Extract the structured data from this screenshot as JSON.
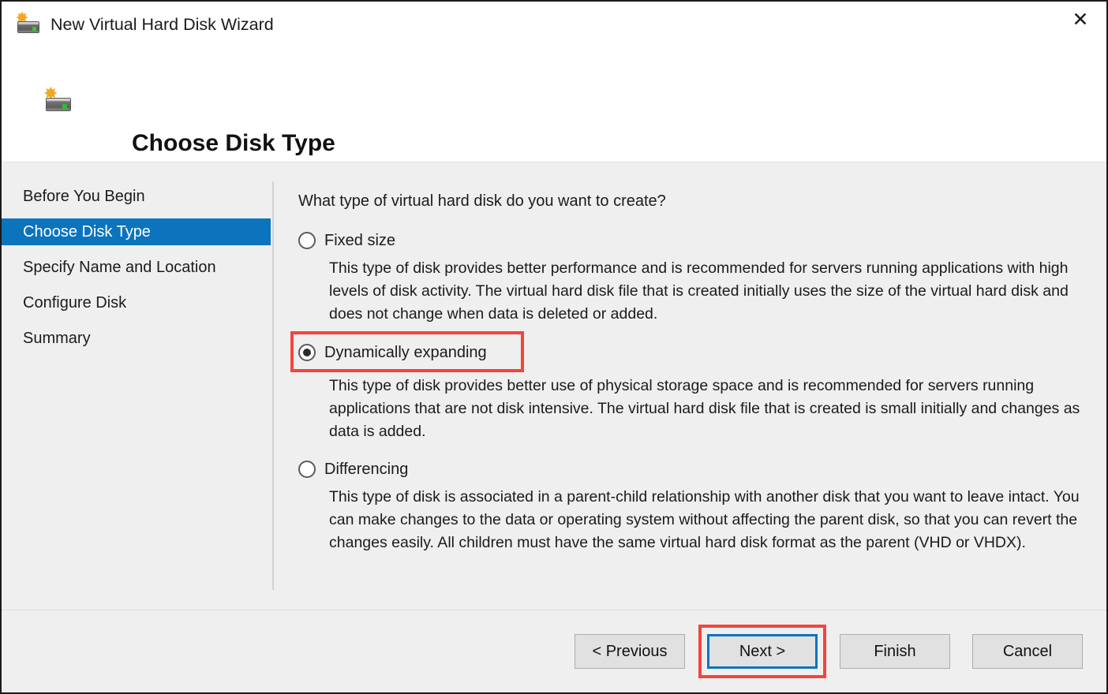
{
  "window": {
    "title": "New Virtual Hard Disk Wizard",
    "title_icon": "virtual-hard-disk-icon",
    "close_label": "✕"
  },
  "header": {
    "icon": "virtual-hard-disk-icon",
    "star_glyph": "✸",
    "page_title": "Choose Disk Type"
  },
  "sidebar": {
    "items": [
      {
        "label": "Before You Begin",
        "selected": false
      },
      {
        "label": "Choose Disk Type",
        "selected": true
      },
      {
        "label": "Specify Name and Location",
        "selected": false
      },
      {
        "label": "Configure Disk",
        "selected": false
      },
      {
        "label": "Summary",
        "selected": false
      }
    ],
    "selected_color": "#0b74bd"
  },
  "main": {
    "question": "What type of virtual hard disk do you want to create?",
    "options": [
      {
        "id": "fixed-size",
        "label": "Fixed size",
        "checked": false,
        "highlighted": false,
        "description": "This type of disk provides better performance and is recommended for servers running applications with high levels of disk activity. The virtual hard disk file that is created initially uses the size of the virtual hard disk and does not change when data is deleted or added."
      },
      {
        "id": "dynamically-expanding",
        "label": "Dynamically expanding",
        "checked": true,
        "highlighted": true,
        "description": "This type of disk provides better use of physical storage space and is recommended for servers running applications that are not disk intensive. The virtual hard disk file that is created is small initially and changes as data is added."
      },
      {
        "id": "differencing",
        "label": "Differencing",
        "checked": false,
        "highlighted": false,
        "description": "This type of disk is associated in a parent-child relationship with another disk that you want to leave intact. You can make changes to the data or operating system without affecting the parent disk, so that you can revert the changes easily. All children must have the same virtual hard disk format as the parent (VHD or VHDX)."
      }
    ]
  },
  "footer": {
    "buttons": [
      {
        "id": "previous",
        "label": "< Previous",
        "focused": false,
        "highlighted": false
      },
      {
        "id": "next",
        "label": "Next >",
        "focused": true,
        "highlighted": true
      },
      {
        "id": "finish",
        "label": "Finish",
        "focused": false,
        "highlighted": false
      },
      {
        "id": "cancel",
        "label": "Cancel",
        "focused": false,
        "highlighted": false
      }
    ]
  },
  "annotations": {
    "highlight_color": "#f4453c",
    "focus_color": "#0b74bd"
  }
}
